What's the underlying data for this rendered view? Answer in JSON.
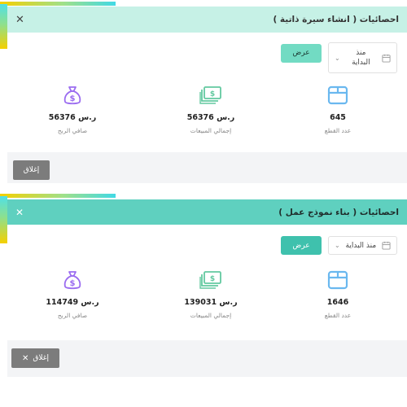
{
  "colors": {
    "header_light": "#c6f1e6",
    "header_teal": "#5fd0bf",
    "accent_yellow": "#f5d000",
    "accent_cyan": "#41d9e5",
    "icon_blue": "#6ab8ef",
    "icon_green": "#63c9a0",
    "icon_purple": "#9b6cf0",
    "close_button": "#7c7c7c"
  },
  "panel1": {
    "title": "احصائيات ( انشاء سيرة ذاتية )",
    "range": "منذ\nالبداية",
    "show_label": "عرض",
    "stats": {
      "pieces": {
        "icon": "box-icon",
        "value": "645",
        "label": "عدد القطع"
      },
      "sales": {
        "icon": "cash-icon",
        "value": "56376 ر.س",
        "label": "إجمالي المبيعات"
      },
      "profit": {
        "icon": "money-bag-icon",
        "value": "56376 ر.س",
        "label": "صافي الربح"
      }
    },
    "close_label": "إغلاق"
  },
  "panel2": {
    "title": "احصائيات ( بناء نموذج عمل )",
    "range": "منذ البداية",
    "show_label": "عرض",
    "stats": {
      "pieces": {
        "icon": "box-icon",
        "value": "1646",
        "label": "عدد القطع"
      },
      "sales": {
        "icon": "cash-icon",
        "value": "139031 ر.س",
        "label": "إجمالي المبيعات"
      },
      "profit": {
        "icon": "money-bag-icon",
        "value": "114749 ر.س",
        "label": "صافي الربح"
      }
    },
    "close_label": "إغلاق"
  }
}
